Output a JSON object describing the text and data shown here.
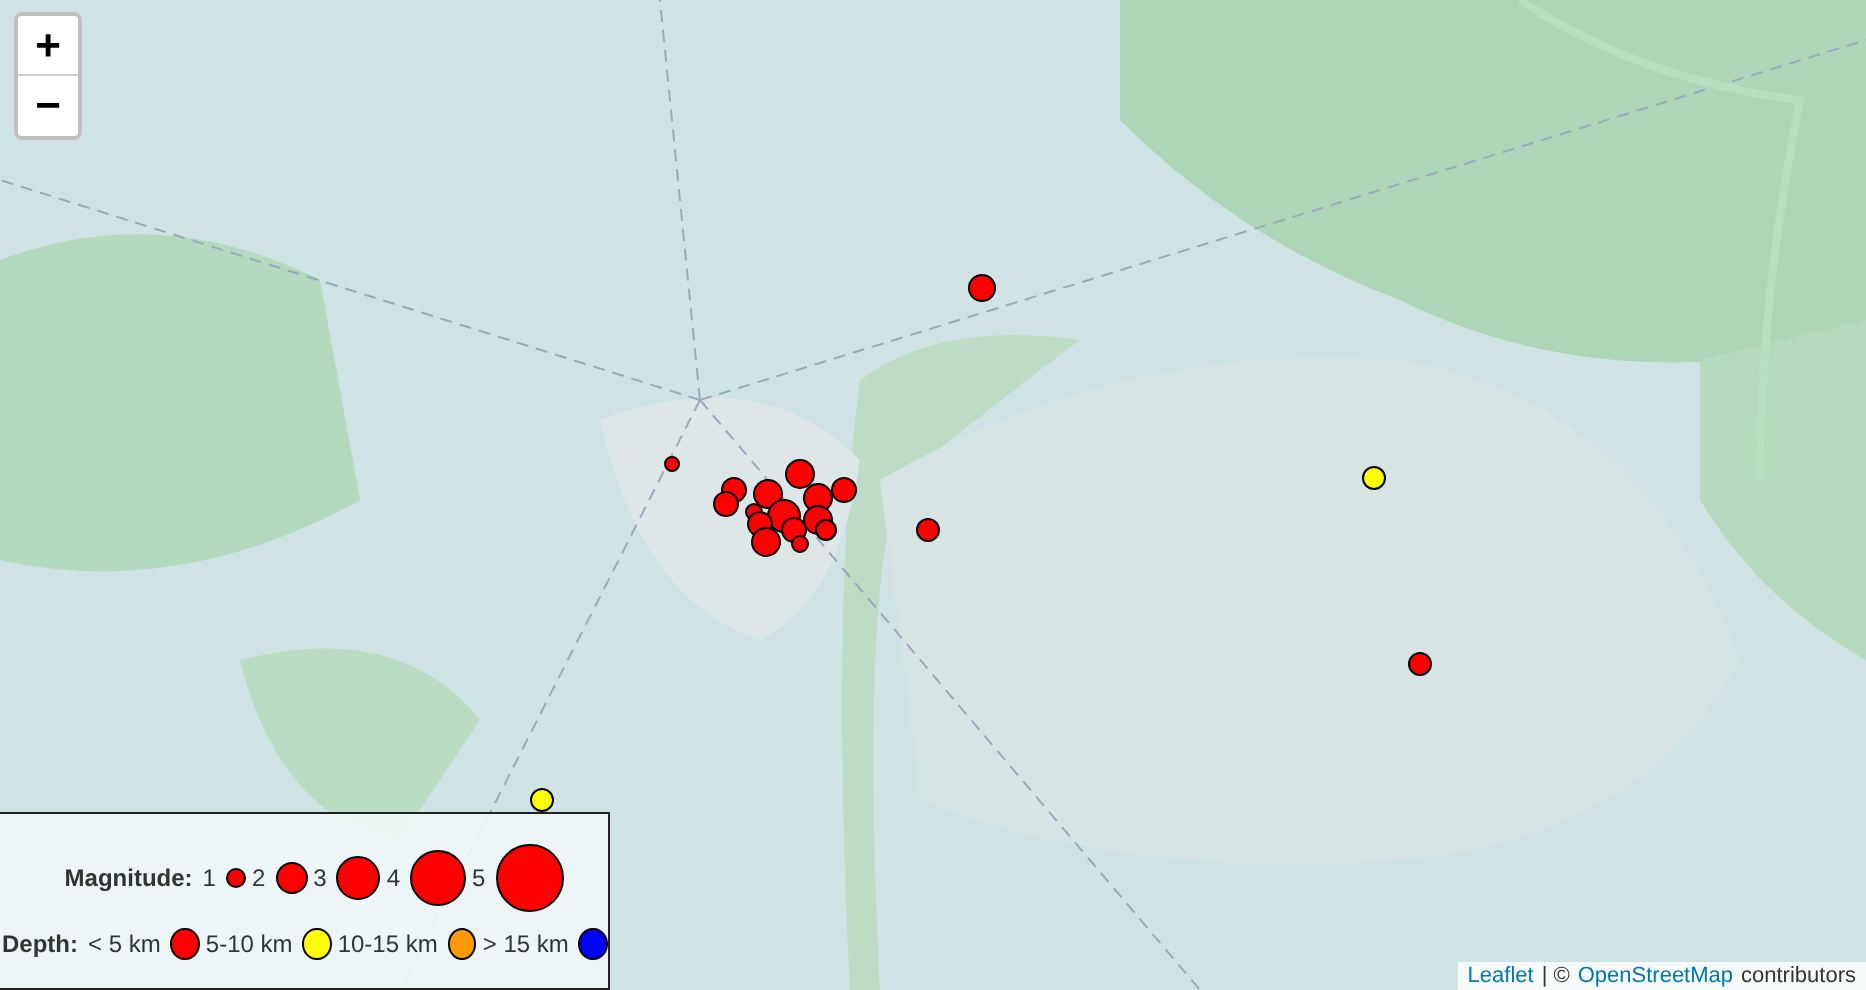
{
  "zoom_controls": [
    {
      "label": "+"
    },
    {
      "label": "−"
    }
  ],
  "markers": [
    {
      "kind": "single",
      "color": "#ff0000"
    },
    {
      "kind": "single",
      "color": "#ff0000"
    },
    {
      "kind": "cluster",
      "color": "#ff0000"
    },
    {
      "kind": "single",
      "color": "#ff0000"
    },
    {
      "kind": "single",
      "color": "#ffff00"
    },
    {
      "kind": "single",
      "color": "#ff0000"
    },
    {
      "kind": "single",
      "color": "#ffff00"
    }
  ],
  "legend": {
    "magnitude_label": "Magnitude:",
    "magnitudes": [
      {
        "label": "1"
      },
      {
        "label": "2"
      },
      {
        "label": "3"
      },
      {
        "label": "4"
      },
      {
        "label": "5"
      }
    ],
    "depth_label": "Depth:",
    "depths": [
      {
        "label": "< 5 km",
        "color": "#ff0000"
      },
      {
        "label": "5-10 km",
        "color": "#ffff00"
      },
      {
        "label": "10-15 km",
        "color": "#ff9900"
      },
      {
        "label": "> 15 km",
        "color": "#0000ff"
      }
    ]
  },
  "attribution": {
    "leaflet": "Leaflet",
    "separator": "| ©",
    "osm": "OpenStreetMap",
    "suffix": "contributors"
  }
}
